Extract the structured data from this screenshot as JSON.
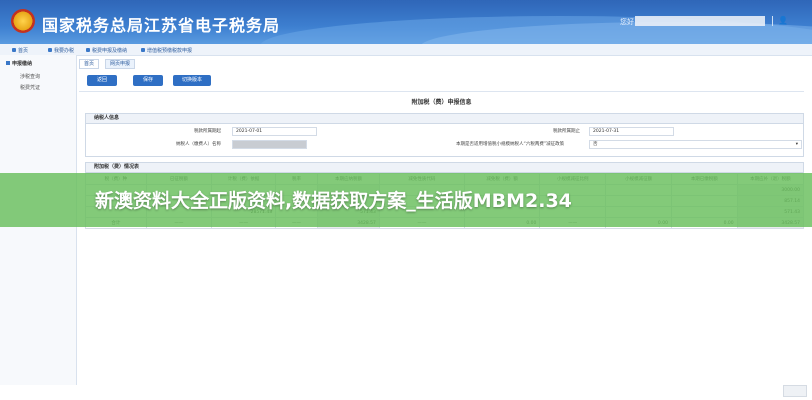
{
  "header": {
    "title": "国家税务总局江苏省电子税务局",
    "user_prefix": "您好",
    "user_icon": "user-icon",
    "colors": {
      "header_top": "#2f66b8",
      "header_bottom": "#5a9be0",
      "button": "#2f6fc4"
    }
  },
  "breadcrumbs": [
    "首页",
    "我要办税",
    "税费申报及缴纳",
    "增值税预缴税款申报"
  ],
  "sidebar": {
    "section": "申报缴纳",
    "items": [
      "涉税查询",
      "税费凭证"
    ]
  },
  "tabs": [
    "首页",
    "网页申报"
  ],
  "toolbar": {
    "back": "返回",
    "save": "保存",
    "submit": "切换版本"
  },
  "page_title": "附加税（费）申报信息",
  "taxpayer": {
    "header": "纳税人信息",
    "period_start_label": "税款所属期起",
    "period_start": "2021-07-01",
    "period_end_label": "税款所属期止",
    "period_end": "2021-07-31",
    "name_label": "纳税人（缴费人）名称",
    "policy_label": "本期是否适用增值税小规模纳税人“六税两费”减征政策",
    "policy_value": "否"
  },
  "table": {
    "header": "附加税（费）情况表",
    "columns": [
      "税（费）种",
      "已征税额",
      "计税（费）依据",
      "税率",
      "本期应纳税额",
      "减免性质代码",
      "减免税（费）额",
      "小规模减征比例",
      "小规模减征额",
      "本期已缴税额",
      "本期应补（退）税额"
    ],
    "rows": [
      {
        "c2": "",
        "c5": "",
        "c11": "3000.00"
      },
      {
        "c2": "",
        "c5": "",
        "c11": "857.14"
      },
      {
        "c2": "28571.43",
        "c5": "571.43",
        "c11": "571.43"
      }
    ],
    "total": {
      "label": "合计",
      "dash": "——",
      "tax": "3428.57",
      "reduce": "0.00",
      "small_reduce": "0.00",
      "paid": "0.00",
      "due": "3428.57"
    }
  },
  "banner": {
    "text": "新澳资料大全正版资料,数据获取方案_生活版MBM2.34"
  }
}
